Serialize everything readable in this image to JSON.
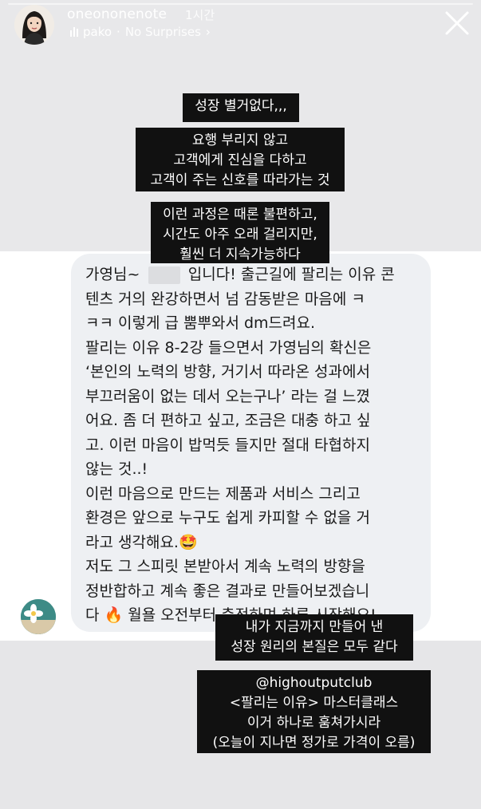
{
  "story_header": {
    "username": "oneononenote",
    "time_ago": "1시간",
    "music_artist": "pako",
    "music_separator": "·",
    "music_song": "No Surprises",
    "music_chevron": "›"
  },
  "captions": {
    "growth_short": "성장 별거없다,,,",
    "principles": "요행 부리지 않고\n고객에게 진심을 다하고\n고객이 주는 신호를 따라가는 것",
    "process": "이런 과정은 때론 불편하고,\n시간도 아주 오래 걸리지만,\n훨씬 더 지속가능하다",
    "essence": "내가 지금까지 만들어 낸\n성장 원리의 본질은 모두 같다",
    "promo": "@highoutputclub\n<팔리는 이유> 마스터클래스\n이거 하나로 훔쳐가시라\n(오늘이 지나면 정가로 가격이 오름)"
  },
  "dm_message": {
    "text": "가영님~          입니다! 출근길에 팔리는 이유 콘\n텐츠 거의 완강하면서 넘 감동받은 마음에 ㅋ\nㅋㅋ 이렇게 급 뿜뿌와서 dm드려요.\n팔리는 이유 8-2강 들으면서 가영님의 확신은\n‘본인의 노력의 방향, 거기서 따라온 성과에서\n부끄러움이 없는 데서 오는구나’ 라는 걸 느꼈\n어요. 좀 더 편하고 싶고, 조금은 대충 하고 싶\n고. 이런 마음이 밥먹듯 들지만 절대 타협하지\n않는 것..!\n이런 마음으로 만드는 제품과 서비스 그리고\n환경은 앞으로 누구도 쉽게 카피할 수 없을 거\n라고 생각해요.🤩\n저도 그 스피릿 본받아서 계속 노력의 방향을\n정반합하고 계속 좋은 결과로 만들어보겠습니\n다 🔥 월욜 오전부터 충전하며 하루 시작해요!"
  },
  "icons": {
    "close": "close-icon",
    "music": "music-bars-icon"
  },
  "colors": {
    "caption_bg": "#111111",
    "caption_text": "#ffffff",
    "bubble_bg": "#eef0f3",
    "story_bg_top": "#e8e8ea",
    "story_bg_mid": "#ffffff"
  }
}
